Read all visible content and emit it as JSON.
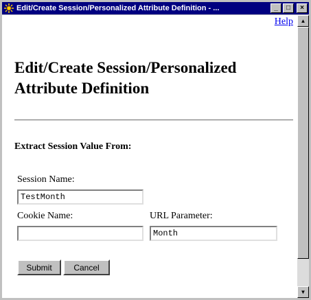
{
  "window": {
    "title": "Edit/Create Session/Personalized Attribute Definition - ...",
    "minimize_glyph": "_",
    "maximize_glyph": "□",
    "close_glyph": "×"
  },
  "help_link": "Help",
  "page_title_line1": "Edit/Create Session/Personalized",
  "page_title_line2": "Attribute Definition",
  "section_heading": "Extract Session Value From:",
  "fields": {
    "session_name": {
      "label": "Session Name:",
      "value": "TestMonth"
    },
    "cookie_name": {
      "label": "Cookie Name:",
      "value": ""
    },
    "url_parameter": {
      "label": "URL Parameter:",
      "value": "Month"
    }
  },
  "buttons": {
    "submit": "Submit",
    "cancel": "Cancel"
  },
  "scrollbar": {
    "up_glyph": "▲",
    "down_glyph": "▼"
  },
  "colors": {
    "titlebar": "#000080",
    "link": "#0000ee"
  }
}
